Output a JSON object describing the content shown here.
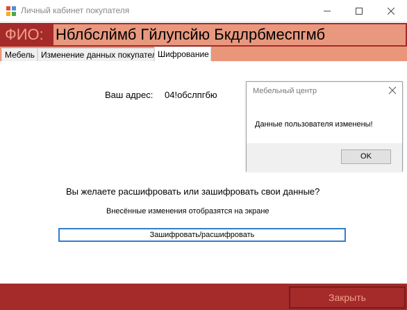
{
  "window": {
    "title": "Личный кабинет покупателя"
  },
  "fio": {
    "label": "ФИО:",
    "value": "Нблбслймб Гйлупсйю Бкдлрбмеспгмб"
  },
  "tabs": [
    {
      "label": "Мебель",
      "active": false
    },
    {
      "label": "Изменение данных покупателя",
      "active": false
    },
    {
      "label": "Шифрование",
      "active": true
    }
  ],
  "encryption": {
    "address_label": "Ваш адрес:",
    "address_value": "04!обслпгбю",
    "question": "Вы желаете расшифровать или зашифровать свои данные?",
    "hint": "Внесённые изменения отобразятся на экране",
    "action_button": "Зашифровать/расшифровать"
  },
  "dialog": {
    "title": "Мебельный центр",
    "message": "Данные пользователя изменены!",
    "ok_label": "OK"
  },
  "footer": {
    "close_label": "Закрыть"
  },
  "colors": {
    "brand_dark": "#a52a2a",
    "brand_light": "#e9967a",
    "accent_text": "#f0a08a",
    "focus_blue": "#2f7fc9"
  }
}
